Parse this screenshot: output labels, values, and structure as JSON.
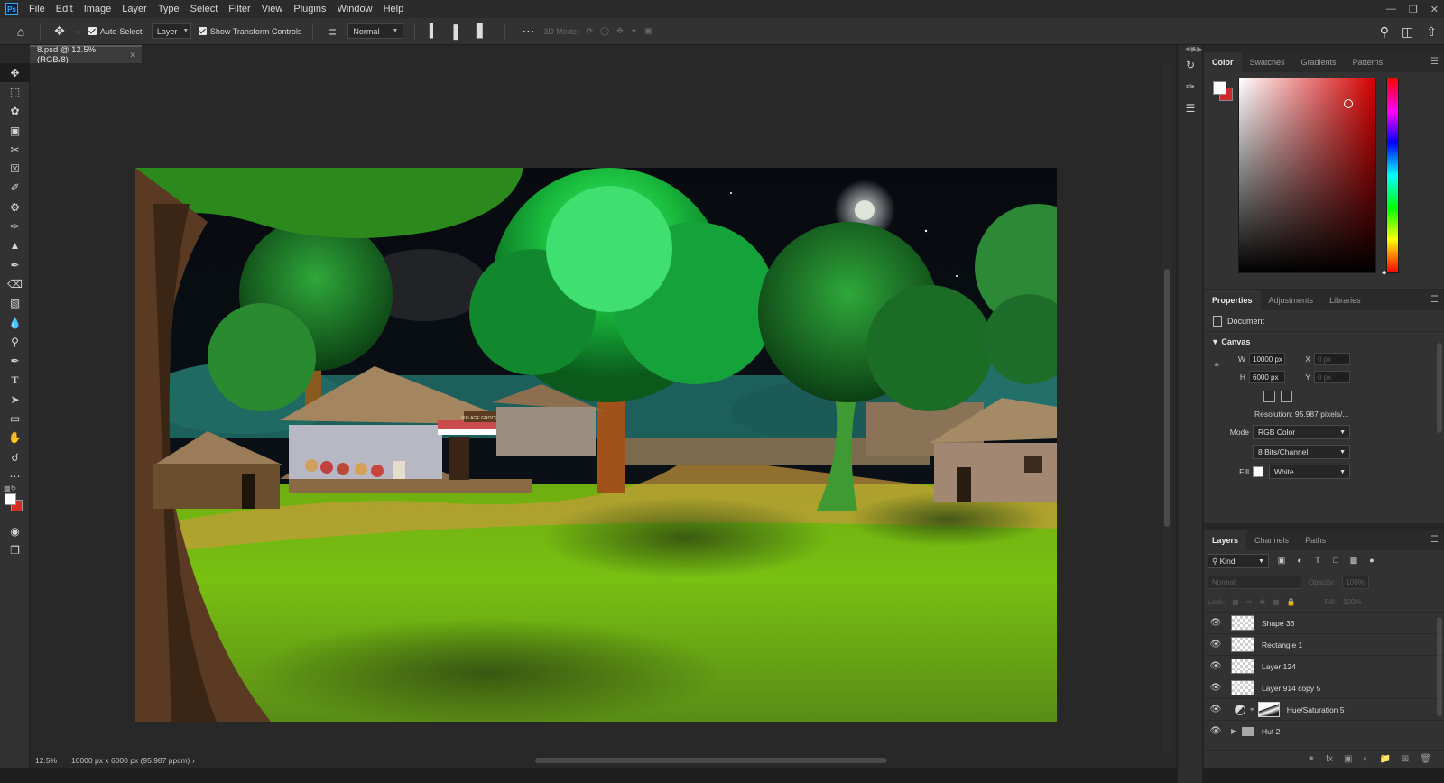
{
  "menubar": {
    "items": [
      "File",
      "Edit",
      "Image",
      "Layer",
      "Type",
      "Select",
      "Filter",
      "View",
      "Plugins",
      "Window",
      "Help"
    ],
    "app_logo": "Ps"
  },
  "options": {
    "auto_select_label": "Auto-Select:",
    "auto_select_target": "Layer",
    "show_transform_label": "Show Transform Controls",
    "blend_mode": "Normal",
    "mode_3d_label": "3D Mode:"
  },
  "document": {
    "tab_title": "8.psd @ 12.5% (RGB/8)",
    "zoom": "12.5%",
    "doc_info": "10000 px x 6000 px (95.987 ppcm)"
  },
  "color_panel": {
    "tabs": [
      "Color",
      "Swatches",
      "Gradients",
      "Patterns"
    ],
    "active_tab": "Color",
    "foreground": "#ffffff",
    "background": "#d02b2b"
  },
  "properties": {
    "tabs": [
      "Properties",
      "Adjustments",
      "Libraries"
    ],
    "document_label": "Document",
    "canvas_label": "Canvas",
    "w_label": "W",
    "w_value": "10000 px",
    "h_label": "H",
    "h_value": "6000 px",
    "x_label": "X",
    "x_placeholder": "0 px",
    "y_label": "Y",
    "y_placeholder": "0 px",
    "resolution": "Resolution:  95.987 pixels/...",
    "mode_label": "Mode",
    "mode_value": "RGB Color",
    "bits_value": "8 Bits/Channel",
    "fill_label": "Fill",
    "fill_value": "White"
  },
  "layers": {
    "tabs": [
      "Layers",
      "Channels",
      "Paths"
    ],
    "kind_label": "Kind",
    "blend_mode": "Normal",
    "opacity_label": "Opacity:",
    "opacity_value": "100%",
    "lock_label": "Lock:",
    "fill_label": "Fill:",
    "fill_value": "100%",
    "items": [
      {
        "name": "Shape 36"
      },
      {
        "name": "Rectangle 1"
      },
      {
        "name": "Layer 124"
      },
      {
        "name": "Layer 914 copy 5"
      },
      {
        "name": "Hue/Saturation 5"
      },
      {
        "name": "Hut 2"
      }
    ]
  },
  "artwork": {
    "shop_sign": "VILLAGE GROCERIES"
  }
}
